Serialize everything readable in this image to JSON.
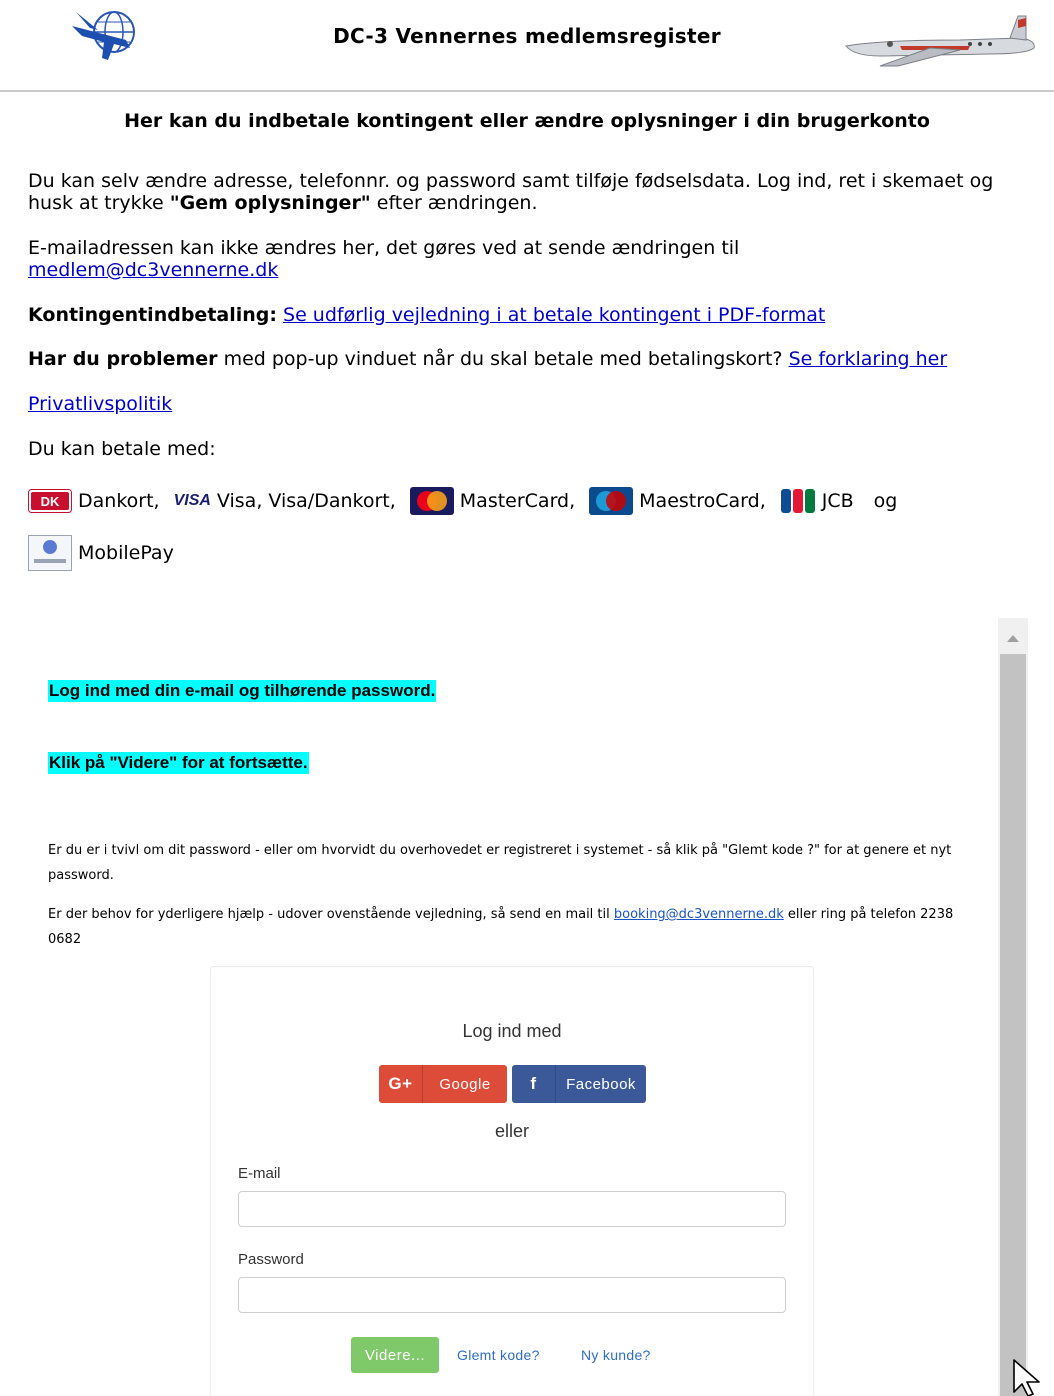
{
  "header": {
    "title": "DC-3 Vennernes medlemsregister"
  },
  "heading": "Her kan du indbetale kontingent eller ændre oplysninger i din brugerkonto",
  "intro": {
    "p1_text": "Du kan selv ændre adresse, telefonnr. og password samt tilføje fødselsdata. Log ind, ret i skemaet og husk at trykke ",
    "p1_bold": "\"Gem oplysninger\"",
    "p1_end": " efter ændringen.",
    "p2_text": "E-mailadressen kan ikke ændres her, det gøres ved at sende ændringen til",
    "p2_link": "medlem@dc3vennerne.dk",
    "p3_bold": "Kontingentindbetaling:",
    "p3_link": "Se udførlig vejledning i at betale kontingent i PDF-format",
    "p4_bold": "Har du problemer",
    "p4_text": " med pop-up vinduet når du skal betale med betalingskort? ",
    "p4_link": "Se forklaring her",
    "p5_link": "Privatlivspolitik",
    "p6_text": "Du kan betale med:"
  },
  "payment": {
    "dankort": "Dankort,",
    "visa": "Visa, Visa/Dankort,",
    "mastercard": "MasterCard,",
    "maestro": "MaestroCard,",
    "jcb": "JCB",
    "og": "og",
    "mobilepay": "MobilePay",
    "visa_logo": "VISA",
    "dk_logo": "DK"
  },
  "frame": {
    "hl1": "Log ind med din e-mail og tilhørende password.",
    "hl2": "Klik på \"Videre\" for at fortsætte.",
    "s1": "Er du er i tvivl om dit password - eller om hvorvidt du overhovedet er registreret i systemet - så klik på \"Glemt kode ?\" for at genere et nyt  password.",
    "s2_text": "Er der behov for yderligere hjælp - udover ovenstående vejledning, så send en mail til ",
    "s2_link": "booking@dc3vennerne.dk",
    "s2_end": " eller ring på telefon 2238 0682"
  },
  "login": {
    "title": "Log ind med",
    "google_icon": "G+",
    "google_label": "Google",
    "facebook_icon": "f",
    "facebook_label": "Facebook",
    "or": "eller",
    "email_label": "E-mail",
    "email_value": "",
    "password_label": "Password",
    "password_value": "",
    "submit": "Videre...",
    "forgot": "Glemt kode?",
    "new_customer": "Ny kunde?"
  },
  "colors": {
    "highlight": "#00ffff",
    "google": "#dd4b39",
    "facebook": "#3b5998",
    "submit": "#7fc96a",
    "link": "#0000cc"
  }
}
